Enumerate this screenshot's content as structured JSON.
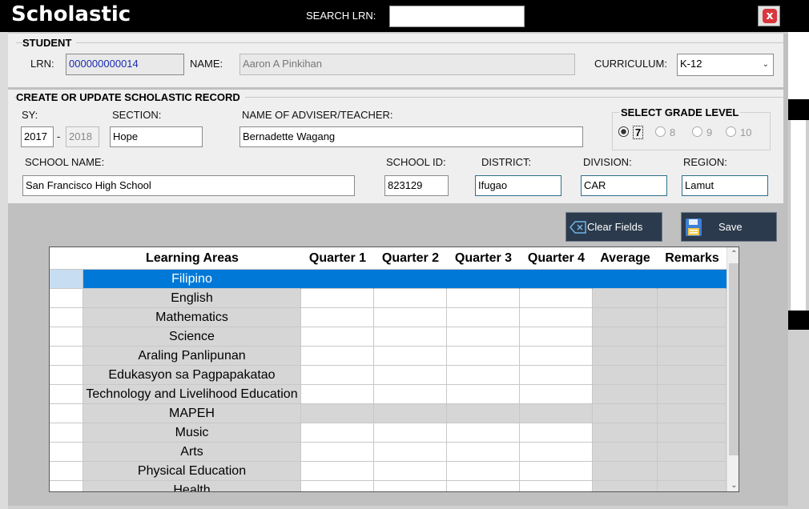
{
  "window": {
    "title": "Scholastic",
    "search_label": "SEARCH LRN:",
    "search_value": "",
    "close_label": "x"
  },
  "student": {
    "group_title": "STUDENT",
    "lrn_label": "LRN:",
    "lrn_value": "000000000014",
    "name_label": "NAME:",
    "name_value": "Aaron A Pinkihan",
    "curriculum_label": "CURRICULUM:",
    "curriculum_value": "K-12"
  },
  "record": {
    "group_title": "CREATE OR UPDATE SCHOLASTIC RECORD",
    "sy_label": "SY:",
    "sy_start": "2017",
    "sy_dash": "-",
    "sy_end": "2018",
    "section_label": "SECTION:",
    "section_value": "Hope",
    "adviser_label": "NAME OF ADVISER/TEACHER:",
    "adviser_value": "Bernadette Wagang",
    "grade_title": "SELECT GRADE LEVEL",
    "grades": [
      "7",
      "8",
      "9",
      "10"
    ],
    "selected_grade": "7",
    "school_name_label": "SCHOOL NAME:",
    "school_name_value": "San Francisco High School",
    "school_id_label": "SCHOOL ID:",
    "school_id_value": "823129",
    "district_label": "DISTRICT:",
    "district_value": "Ifugao",
    "division_label": "DIVISION:",
    "division_value": "CAR",
    "region_label": "REGION:",
    "region_value": "Lamut"
  },
  "buttons": {
    "clear_label": "Clear Fields",
    "save_label": "Save"
  },
  "colors": {
    "titlebar": "#000000",
    "selection": "#0078d7",
    "button": "#2b3a4c",
    "close": "#d9363e"
  },
  "table": {
    "columns": [
      "Learning Areas",
      "Quarter 1",
      "Quarter 2",
      "Quarter 3",
      "Quarter 4",
      "Average",
      "Remarks"
    ],
    "rows": [
      {
        "area": "Filipino",
        "selected": true
      },
      {
        "area": "English"
      },
      {
        "area": "Mathematics"
      },
      {
        "area": "Science"
      },
      {
        "area": "Araling Panlipunan"
      },
      {
        "area": "Edukasyon sa Pagpapakatao"
      },
      {
        "area": "Technology and Livelihood Education"
      },
      {
        "area": "MAPEH"
      },
      {
        "area": "Music"
      },
      {
        "area": "Arts"
      },
      {
        "area": "Physical Education"
      },
      {
        "area": "Health"
      }
    ]
  }
}
